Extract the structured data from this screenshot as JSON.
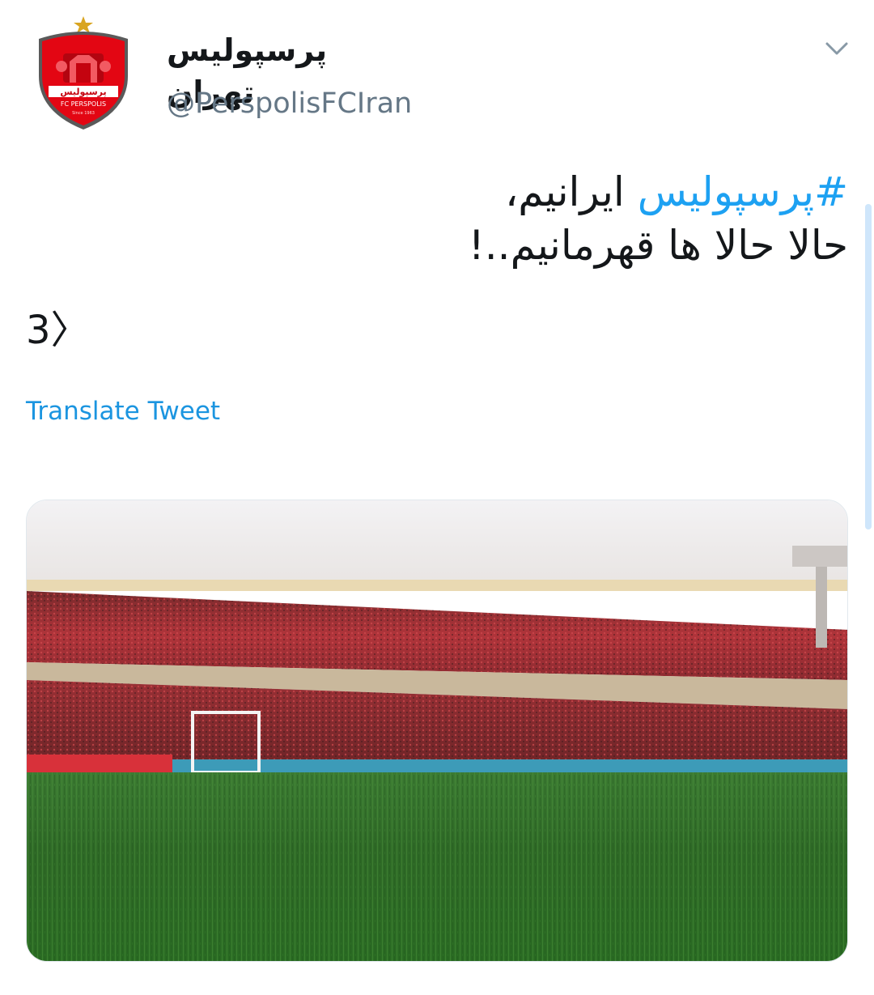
{
  "author": {
    "display_name": "پرسپولیس تهران",
    "handle": "@PerspolisFCIran",
    "avatar_icon": "perspolis-crest-icon",
    "avatar_text": {
      "farsi": "پرسپولیس",
      "english": "FC PERSPOLIS",
      "since": "Since 1963"
    }
  },
  "menu_icon": "chevron-down-icon",
  "tweet": {
    "hashtag": "#پرسپولیس",
    "line1_rest": " ایرانیم،",
    "line2": "حالا حالا ها قهرمانیم..!",
    "emoticon": "3>",
    "translate_label": "Translate Tweet"
  },
  "media": {
    "type": "photo",
    "subject": "stadium-crowd-photo"
  },
  "colors": {
    "link_blue": "#1da1f2",
    "translate_blue": "#1b95e0",
    "handle_gray": "#657786",
    "text_dark": "#14171a",
    "brand_red": "#e30613"
  }
}
